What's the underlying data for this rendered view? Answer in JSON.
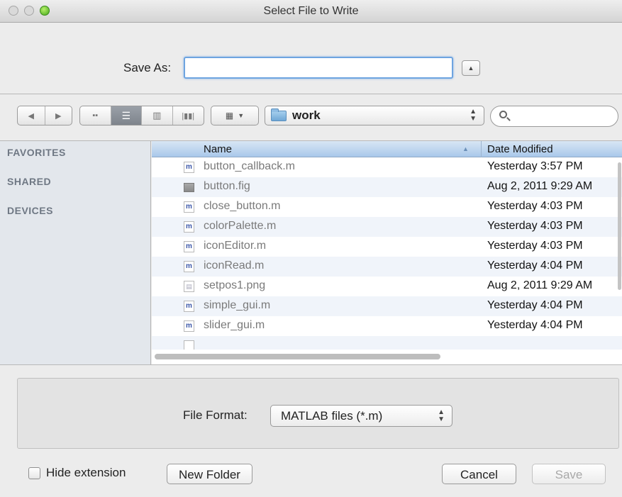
{
  "window": {
    "title": "Select File to Write"
  },
  "save_as": {
    "label": "Save As:",
    "value": ""
  },
  "toolbar": {
    "current_folder": "work",
    "search_placeholder": ""
  },
  "sidebar": {
    "sections": [
      "FAVORITES",
      "SHARED",
      "DEVICES"
    ]
  },
  "file_list": {
    "columns": {
      "name": "Name",
      "date": "Date Modified"
    },
    "rows": [
      {
        "name": "button_callback.m",
        "date": "Yesterday 3:57 PM",
        "type": "m"
      },
      {
        "name": "button.fig",
        "date": "Aug 2, 2011 9:29 AM",
        "type": "fig"
      },
      {
        "name": "close_button.m",
        "date": "Yesterday 4:03 PM",
        "type": "m"
      },
      {
        "name": "colorPalette.m",
        "date": "Yesterday 4:03 PM",
        "type": "m"
      },
      {
        "name": "iconEditor.m",
        "date": "Yesterday 4:03 PM",
        "type": "m"
      },
      {
        "name": "iconRead.m",
        "date": "Yesterday 4:04 PM",
        "type": "m"
      },
      {
        "name": "setpos1.png",
        "date": "Aug 2, 2011 9:29 AM",
        "type": "png"
      },
      {
        "name": "simple_gui.m",
        "date": "Yesterday 4:04 PM",
        "type": "m"
      },
      {
        "name": "slider_gui.m",
        "date": "Yesterday 4:04 PM",
        "type": "m"
      }
    ]
  },
  "file_format": {
    "label": "File Format:",
    "value": "MATLAB files (*.m)"
  },
  "footer": {
    "hide_extension": "Hide extension",
    "new_folder": "New Folder",
    "cancel": "Cancel",
    "save": "Save"
  }
}
